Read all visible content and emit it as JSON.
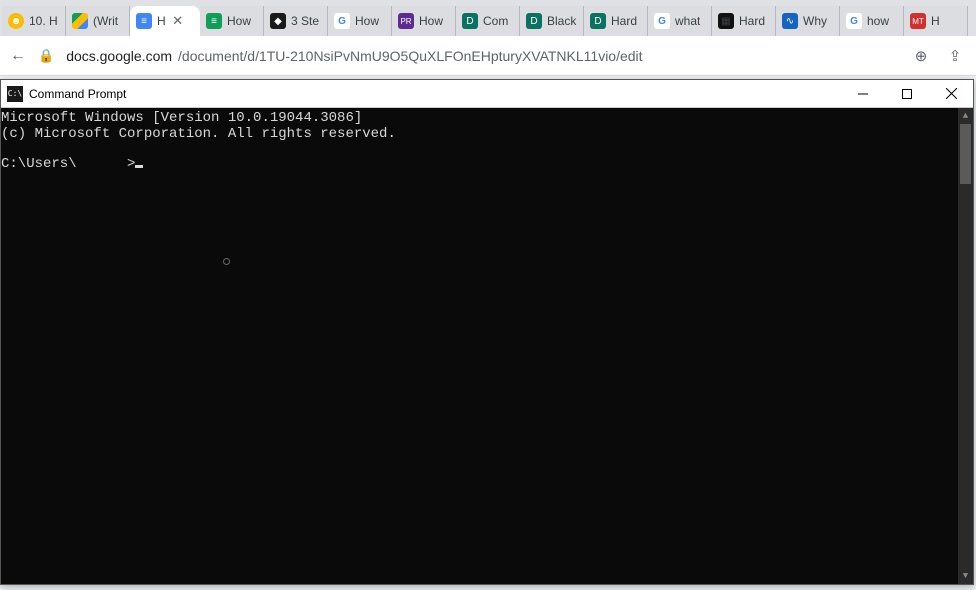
{
  "tabs": [
    {
      "title": "10. H",
      "favicon": "fi-yellow",
      "fchar": "☻"
    },
    {
      "title": "(Writ",
      "favicon": "fi-drive",
      "fchar": ""
    },
    {
      "title": "H",
      "favicon": "fi-docs",
      "fchar": "≡",
      "active": true
    },
    {
      "title": "How",
      "favicon": "fi-green",
      "fchar": "≡"
    },
    {
      "title": "3 Ste",
      "favicon": "fi-black",
      "fchar": "◆"
    },
    {
      "title": "How",
      "favicon": "fi-g",
      "fchar": "G"
    },
    {
      "title": "How",
      "favicon": "fi-pr",
      "fchar": "PR"
    },
    {
      "title": "Com",
      "favicon": "fi-d",
      "fchar": "D"
    },
    {
      "title": "Black",
      "favicon": "fi-d",
      "fchar": "D"
    },
    {
      "title": "Hard",
      "favicon": "fi-d",
      "fchar": "D"
    },
    {
      "title": "what",
      "favicon": "fi-g",
      "fchar": "G"
    },
    {
      "title": "Hard",
      "favicon": "fi-dk",
      "fchar": "▦"
    },
    {
      "title": "Why",
      "favicon": "fi-blue",
      "fchar": "∿"
    },
    {
      "title": "how",
      "favicon": "fi-g",
      "fchar": "G"
    },
    {
      "title": "H",
      "favicon": "fi-mt",
      "fchar": "MT"
    }
  ],
  "url": {
    "domain": "docs.google.com",
    "path": "/document/d/1TU-210NsiPvNmU9O5QuXLFOnEHpturyXVATNKL11vio/edit"
  },
  "cmd": {
    "title": "Command Prompt",
    "icon_text": "C:\\",
    "line1": "Microsoft Windows [Version 10.0.19044.3086]",
    "line2": "(c) Microsoft Corporation. All rights reserved.",
    "prompt": "C:\\Users\\      >"
  }
}
